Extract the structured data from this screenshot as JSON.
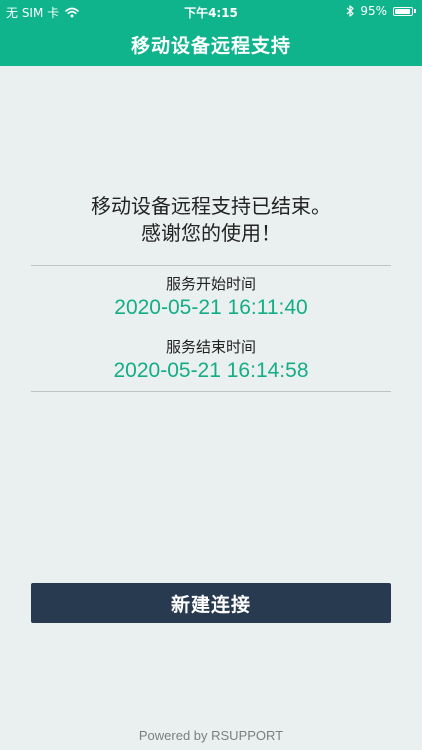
{
  "status_bar": {
    "carrier": "无 SIM 卡",
    "wifi_icon": "wifi-icon",
    "time": "下午4:15",
    "bluetooth_icon": "bluetooth-icon",
    "battery_percent": "95%",
    "battery_level": 0.95
  },
  "header": {
    "title": "移动设备远程支持"
  },
  "message": {
    "line1": "移动设备远程支持已结束。",
    "line2": "感谢您的使用！"
  },
  "service": {
    "start_label": "服务开始时间",
    "start_time": "2020-05-21 16:11:40",
    "end_label": "服务结束时间",
    "end_time": "2020-05-21 16:14:58"
  },
  "actions": {
    "new_connection_label": "新建连接"
  },
  "footer": {
    "powered_by": "Powered by RSUPPORT"
  },
  "colors": {
    "brand_green": "#0fb48c",
    "value_green": "#14ad87",
    "button_navy": "#273a50",
    "background": "#eaf0ef"
  }
}
